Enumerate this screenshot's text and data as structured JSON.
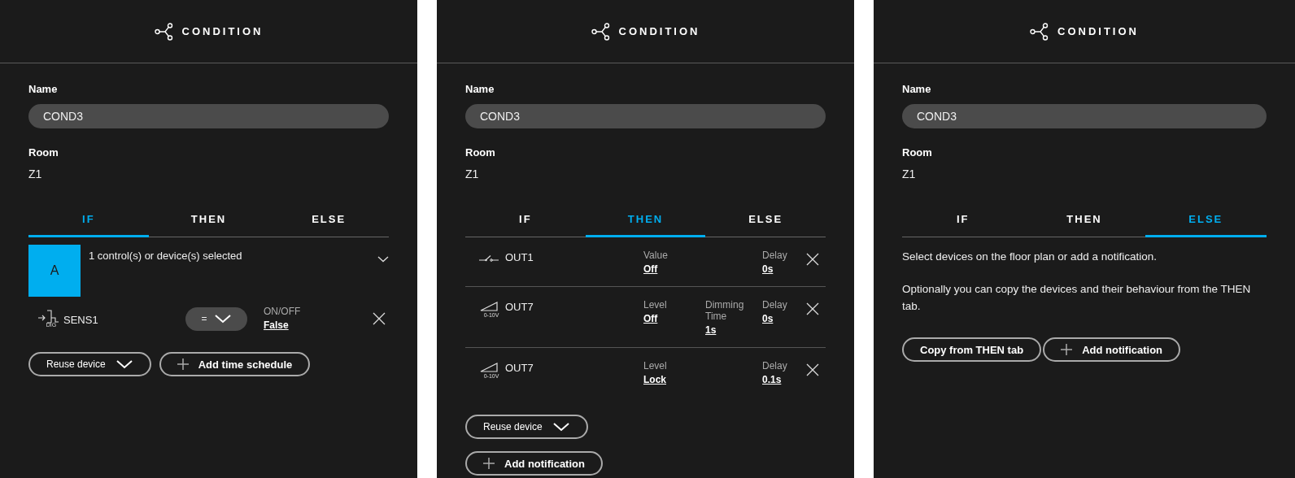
{
  "panels": [
    {
      "title": "CONDITION",
      "name_label": "Name",
      "name_value": "COND3",
      "room_label": "Room",
      "room_value": "Z1",
      "tabs": [
        {
          "label": "IF",
          "selected": true
        },
        {
          "label": "THEN",
          "selected": false
        },
        {
          "label": "ELSE",
          "selected": false
        }
      ],
      "content": {
        "kind": "if",
        "group_letter": "A",
        "summary": "1 control(s) or device(s) selected",
        "conditions": [
          {
            "device": "SENS1",
            "icon_caption": "DIG",
            "operator": "=",
            "property_label": "ON/OFF",
            "property_value": "False"
          }
        ],
        "buttons": [
          {
            "kind": "dropdown",
            "label": "Reuse device"
          },
          {
            "kind": "add",
            "label": "Add time schedule"
          }
        ]
      }
    },
    {
      "title": "CONDITION",
      "name_label": "Name",
      "name_value": "COND3",
      "room_label": "Room",
      "room_value": "Z1",
      "tabs": [
        {
          "label": "IF",
          "selected": false
        },
        {
          "label": "THEN",
          "selected": true
        },
        {
          "label": "ELSE",
          "selected": false
        }
      ],
      "content": {
        "kind": "then",
        "actions": [
          {
            "kind": "switch",
            "device": "OUT1",
            "setting": {
              "label": "Value",
              "value": "Off"
            },
            "delay": {
              "label": "Delay",
              "value": "0s"
            }
          },
          {
            "kind": "dimmer",
            "icon_caption": "0-10V",
            "device": "OUT7",
            "setting": {
              "label": "Level",
              "value": "Off"
            },
            "dimming": {
              "label": "Dimming Time",
              "value": "1s"
            },
            "delay": {
              "label": "Delay",
              "value": "0s"
            }
          },
          {
            "kind": "dimmer",
            "icon_caption": "0-10V",
            "device": "OUT7",
            "setting": {
              "label": "Level",
              "value": "Lock"
            },
            "delay": {
              "label": "Delay",
              "value": "0.1s"
            }
          }
        ],
        "buttons": [
          {
            "kind": "dropdown",
            "label": "Reuse device"
          },
          {
            "kind": "add",
            "label": "Add notification"
          }
        ]
      }
    },
    {
      "title": "CONDITION",
      "name_label": "Name",
      "name_value": "COND3",
      "room_label": "Room",
      "room_value": "Z1",
      "tabs": [
        {
          "label": "IF",
          "selected": false
        },
        {
          "label": "THEN",
          "selected": false
        },
        {
          "label": "ELSE",
          "selected": true
        }
      ],
      "content": {
        "kind": "else",
        "paragraphs": [
          "Select devices on the floor plan or add a notification.",
          "Optionally you can copy the devices and their behaviour from the THEN tab."
        ],
        "buttons": [
          {
            "kind": "plain",
            "label": "Copy from THEN tab"
          },
          {
            "kind": "add",
            "label": "Add notification"
          }
        ]
      }
    }
  ]
}
